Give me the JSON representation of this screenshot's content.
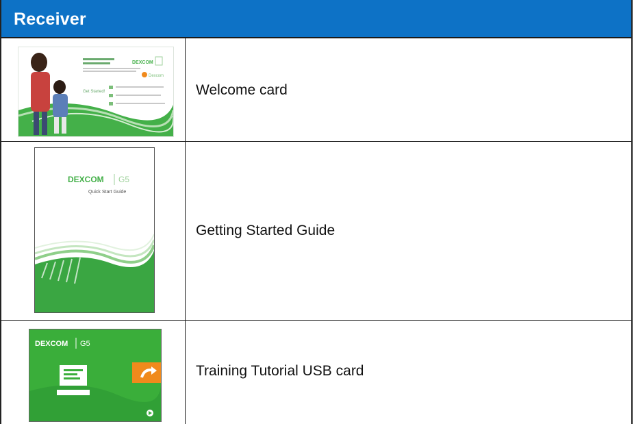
{
  "header": {
    "title": "Receiver"
  },
  "rows": [
    {
      "label": "Welcome card"
    },
    {
      "label": "Getting Started Guide"
    },
    {
      "label": "Training Tutorial USB card"
    }
  ],
  "brand": {
    "name": "DEXCOM",
    "product": "G5",
    "guide_subtitle": "Quick Start Guide"
  },
  "colors": {
    "header_bg": "#0d72c6",
    "brand_green": "#3aae3a",
    "accent_orange": "#f08a1c"
  }
}
